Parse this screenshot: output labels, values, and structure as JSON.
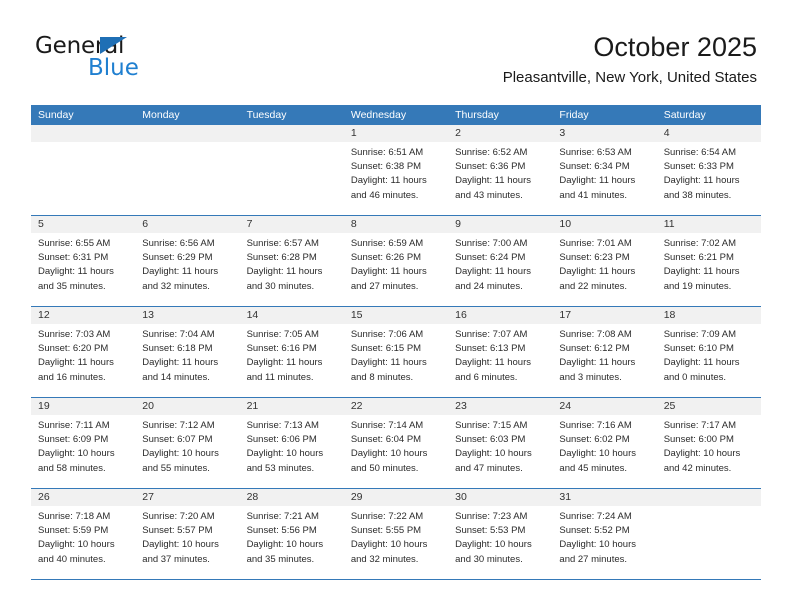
{
  "brand": {
    "name_top": "General",
    "name_bottom": "Blue",
    "triangle_color": "#1f6fb5",
    "blue_text_color": "#1f7fd0"
  },
  "header": {
    "title": "October 2025",
    "subtitle": "Pleasantville, New York, United States"
  },
  "theme": {
    "header_bar_color": "#3579b8",
    "day_number_band_color": "#f1f1f1",
    "grid_line_color": "#3579b8",
    "text_color": "#2b2b2b"
  },
  "calendar": {
    "weekday_headers": [
      "Sunday",
      "Monday",
      "Tuesday",
      "Wednesday",
      "Thursday",
      "Friday",
      "Saturday"
    ],
    "weeks": [
      [
        {
          "day": "",
          "empty": true
        },
        {
          "day": "",
          "empty": true
        },
        {
          "day": "",
          "empty": true
        },
        {
          "day": "1",
          "sunrise": "Sunrise: 6:51 AM",
          "sunset": "Sunset: 6:38 PM",
          "daylight_line1": "Daylight: 11 hours",
          "daylight_line2": "and 46 minutes."
        },
        {
          "day": "2",
          "sunrise": "Sunrise: 6:52 AM",
          "sunset": "Sunset: 6:36 PM",
          "daylight_line1": "Daylight: 11 hours",
          "daylight_line2": "and 43 minutes."
        },
        {
          "day": "3",
          "sunrise": "Sunrise: 6:53 AM",
          "sunset": "Sunset: 6:34 PM",
          "daylight_line1": "Daylight: 11 hours",
          "daylight_line2": "and 41 minutes."
        },
        {
          "day": "4",
          "sunrise": "Sunrise: 6:54 AM",
          "sunset": "Sunset: 6:33 PM",
          "daylight_line1": "Daylight: 11 hours",
          "daylight_line2": "and 38 minutes."
        }
      ],
      [
        {
          "day": "5",
          "sunrise": "Sunrise: 6:55 AM",
          "sunset": "Sunset: 6:31 PM",
          "daylight_line1": "Daylight: 11 hours",
          "daylight_line2": "and 35 minutes."
        },
        {
          "day": "6",
          "sunrise": "Sunrise: 6:56 AM",
          "sunset": "Sunset: 6:29 PM",
          "daylight_line1": "Daylight: 11 hours",
          "daylight_line2": "and 32 minutes."
        },
        {
          "day": "7",
          "sunrise": "Sunrise: 6:57 AM",
          "sunset": "Sunset: 6:28 PM",
          "daylight_line1": "Daylight: 11 hours",
          "daylight_line2": "and 30 minutes."
        },
        {
          "day": "8",
          "sunrise": "Sunrise: 6:59 AM",
          "sunset": "Sunset: 6:26 PM",
          "daylight_line1": "Daylight: 11 hours",
          "daylight_line2": "and 27 minutes."
        },
        {
          "day": "9",
          "sunrise": "Sunrise: 7:00 AM",
          "sunset": "Sunset: 6:24 PM",
          "daylight_line1": "Daylight: 11 hours",
          "daylight_line2": "and 24 minutes."
        },
        {
          "day": "10",
          "sunrise": "Sunrise: 7:01 AM",
          "sunset": "Sunset: 6:23 PM",
          "daylight_line1": "Daylight: 11 hours",
          "daylight_line2": "and 22 minutes."
        },
        {
          "day": "11",
          "sunrise": "Sunrise: 7:02 AM",
          "sunset": "Sunset: 6:21 PM",
          "daylight_line1": "Daylight: 11 hours",
          "daylight_line2": "and 19 minutes."
        }
      ],
      [
        {
          "day": "12",
          "sunrise": "Sunrise: 7:03 AM",
          "sunset": "Sunset: 6:20 PM",
          "daylight_line1": "Daylight: 11 hours",
          "daylight_line2": "and 16 minutes."
        },
        {
          "day": "13",
          "sunrise": "Sunrise: 7:04 AM",
          "sunset": "Sunset: 6:18 PM",
          "daylight_line1": "Daylight: 11 hours",
          "daylight_line2": "and 14 minutes."
        },
        {
          "day": "14",
          "sunrise": "Sunrise: 7:05 AM",
          "sunset": "Sunset: 6:16 PM",
          "daylight_line1": "Daylight: 11 hours",
          "daylight_line2": "and 11 minutes."
        },
        {
          "day": "15",
          "sunrise": "Sunrise: 7:06 AM",
          "sunset": "Sunset: 6:15 PM",
          "daylight_line1": "Daylight: 11 hours",
          "daylight_line2": "and 8 minutes."
        },
        {
          "day": "16",
          "sunrise": "Sunrise: 7:07 AM",
          "sunset": "Sunset: 6:13 PM",
          "daylight_line1": "Daylight: 11 hours",
          "daylight_line2": "and 6 minutes."
        },
        {
          "day": "17",
          "sunrise": "Sunrise: 7:08 AM",
          "sunset": "Sunset: 6:12 PM",
          "daylight_line1": "Daylight: 11 hours",
          "daylight_line2": "and 3 minutes."
        },
        {
          "day": "18",
          "sunrise": "Sunrise: 7:09 AM",
          "sunset": "Sunset: 6:10 PM",
          "daylight_line1": "Daylight: 11 hours",
          "daylight_line2": "and 0 minutes."
        }
      ],
      [
        {
          "day": "19",
          "sunrise": "Sunrise: 7:11 AM",
          "sunset": "Sunset: 6:09 PM",
          "daylight_line1": "Daylight: 10 hours",
          "daylight_line2": "and 58 minutes."
        },
        {
          "day": "20",
          "sunrise": "Sunrise: 7:12 AM",
          "sunset": "Sunset: 6:07 PM",
          "daylight_line1": "Daylight: 10 hours",
          "daylight_line2": "and 55 minutes."
        },
        {
          "day": "21",
          "sunrise": "Sunrise: 7:13 AM",
          "sunset": "Sunset: 6:06 PM",
          "daylight_line1": "Daylight: 10 hours",
          "daylight_line2": "and 53 minutes."
        },
        {
          "day": "22",
          "sunrise": "Sunrise: 7:14 AM",
          "sunset": "Sunset: 6:04 PM",
          "daylight_line1": "Daylight: 10 hours",
          "daylight_line2": "and 50 minutes."
        },
        {
          "day": "23",
          "sunrise": "Sunrise: 7:15 AM",
          "sunset": "Sunset: 6:03 PM",
          "daylight_line1": "Daylight: 10 hours",
          "daylight_line2": "and 47 minutes."
        },
        {
          "day": "24",
          "sunrise": "Sunrise: 7:16 AM",
          "sunset": "Sunset: 6:02 PM",
          "daylight_line1": "Daylight: 10 hours",
          "daylight_line2": "and 45 minutes."
        },
        {
          "day": "25",
          "sunrise": "Sunrise: 7:17 AM",
          "sunset": "Sunset: 6:00 PM",
          "daylight_line1": "Daylight: 10 hours",
          "daylight_line2": "and 42 minutes."
        }
      ],
      [
        {
          "day": "26",
          "sunrise": "Sunrise: 7:18 AM",
          "sunset": "Sunset: 5:59 PM",
          "daylight_line1": "Daylight: 10 hours",
          "daylight_line2": "and 40 minutes."
        },
        {
          "day": "27",
          "sunrise": "Sunrise: 7:20 AM",
          "sunset": "Sunset: 5:57 PM",
          "daylight_line1": "Daylight: 10 hours",
          "daylight_line2": "and 37 minutes."
        },
        {
          "day": "28",
          "sunrise": "Sunrise: 7:21 AM",
          "sunset": "Sunset: 5:56 PM",
          "daylight_line1": "Daylight: 10 hours",
          "daylight_line2": "and 35 minutes."
        },
        {
          "day": "29",
          "sunrise": "Sunrise: 7:22 AM",
          "sunset": "Sunset: 5:55 PM",
          "daylight_line1": "Daylight: 10 hours",
          "daylight_line2": "and 32 minutes."
        },
        {
          "day": "30",
          "sunrise": "Sunrise: 7:23 AM",
          "sunset": "Sunset: 5:53 PM",
          "daylight_line1": "Daylight: 10 hours",
          "daylight_line2": "and 30 minutes."
        },
        {
          "day": "31",
          "sunrise": "Sunrise: 7:24 AM",
          "sunset": "Sunset: 5:52 PM",
          "daylight_line1": "Daylight: 10 hours",
          "daylight_line2": "and 27 minutes."
        },
        {
          "day": "",
          "empty": true
        }
      ]
    ]
  }
}
